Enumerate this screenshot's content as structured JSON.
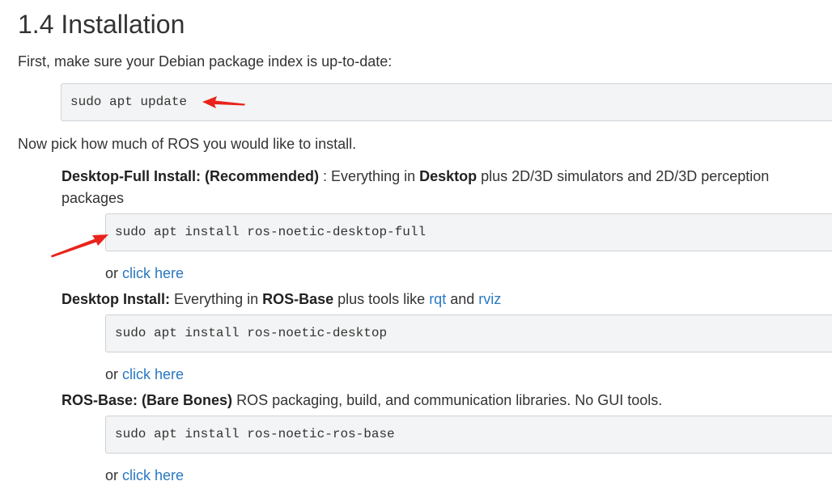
{
  "heading": "1.4 Installation",
  "intro": "First, make sure your Debian package index is up-to-date:",
  "update_cmd": "sudo apt update",
  "pick_text": "Now pick how much of ROS you would like to install.",
  "options": [
    {
      "title_bold": "Desktop-Full Install: (Recommended)",
      "desc_pre": " : Everything in ",
      "desc_bold": "Desktop",
      "desc_post": " plus 2D/3D simulators and 2D/3D perception",
      "desc_line2": "packages",
      "command": "sudo apt install ros-noetic-desktop-full",
      "or_text": "or ",
      "link_text": "click here"
    },
    {
      "title_bold": "Desktop Install:",
      "desc_pre": " Everything in ",
      "desc_bold": "ROS-Base",
      "desc_post": " plus tools like ",
      "link1": "rqt",
      "and_text": " and ",
      "link2": "rviz",
      "command": "sudo apt install ros-noetic-desktop",
      "or_text": "or ",
      "link_text": "click here"
    },
    {
      "title_bold": "ROS-Base: (Bare Bones)",
      "desc_post": " ROS packaging, build, and communication libraries. No GUI tools.",
      "command": "sudo apt install ros-noetic-ros-base",
      "or_text": "or ",
      "link_text": "click here"
    }
  ],
  "annotation_color": "#e8231b"
}
